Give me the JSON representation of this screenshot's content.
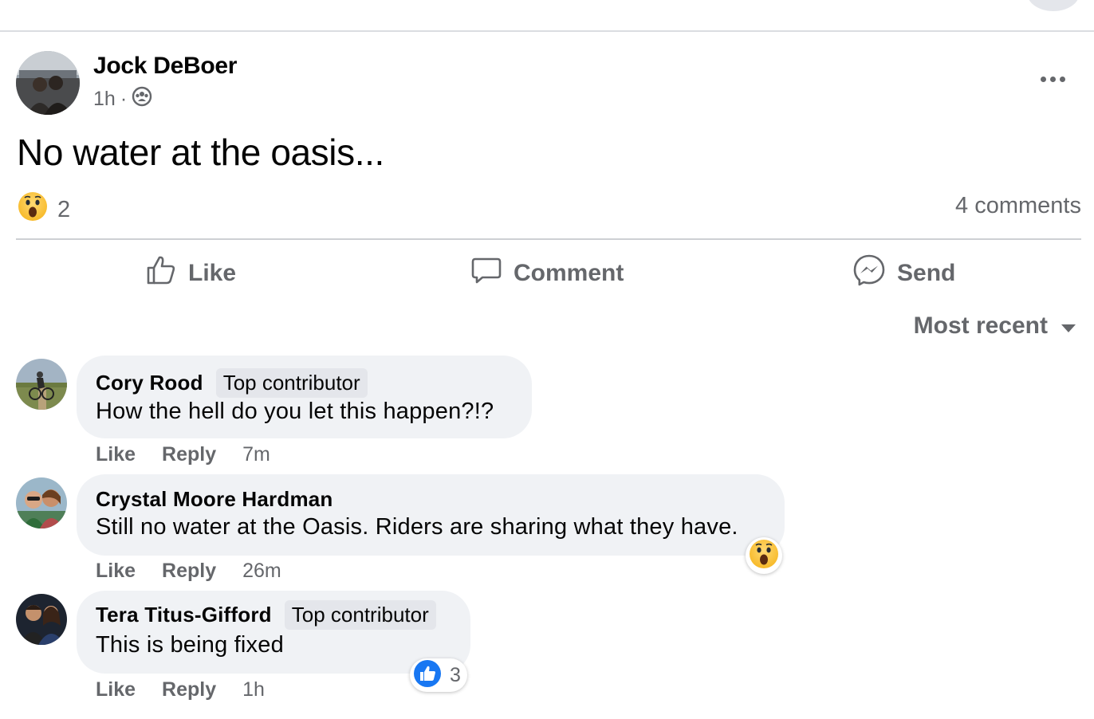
{
  "post": {
    "author": "Jock DeBoer",
    "time": "1h",
    "separator": "·",
    "audience_icon": "group-icon",
    "text": "No water at the oasis...",
    "reaction_count": "2",
    "reaction_icon": "wow-emoji-icon",
    "comments_count": "4 comments"
  },
  "actions": {
    "like": "Like",
    "comment": "Comment",
    "send": "Send"
  },
  "sort": {
    "label": "Most recent"
  },
  "comments": [
    {
      "name": "Cory Rood",
      "badge": "Top contributor",
      "text": "How the hell do you let this happen?!?",
      "like": "Like",
      "reply": "Reply",
      "time": "7m"
    },
    {
      "name": "Crystal Moore Hardman",
      "badge": "",
      "text": "Still no water at the Oasis. Riders are sharing what they have.",
      "like": "Like",
      "reply": "Reply",
      "time": "26m",
      "reaction_icon": "wow-emoji-icon"
    },
    {
      "name": "Tera Titus-Gifford",
      "badge": "Top contributor",
      "text": "This is being fixed",
      "like": "Like",
      "reply": "Reply",
      "time": "1h",
      "reaction_icon": "like-thumb-icon",
      "reaction_count": "3"
    }
  ],
  "colors": {
    "secondary_text": "#65676b",
    "bubble": "#f0f2f5",
    "like_blue": "#1877f2",
    "wow_yellow": "#f7b928"
  }
}
